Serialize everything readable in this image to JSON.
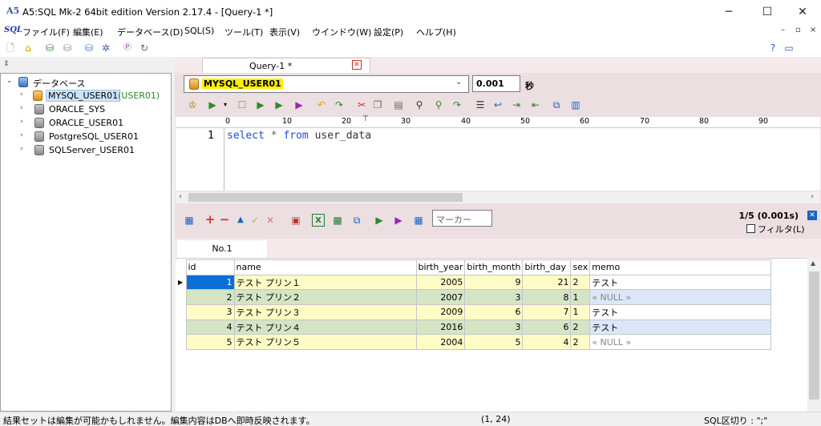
{
  "window": {
    "title": "A5:SQL Mk-2 64bit edition Version 2.17.4 - [Query-1 *]",
    "minimize": "─",
    "maximize": "☐",
    "close": "✕"
  },
  "menu": {
    "logo": "SQL",
    "items": [
      "ファイル(F)",
      "編集(E)",
      "データベース(D)",
      "SQL(S)",
      "ツール(T)",
      "表示(V)",
      "ウインドウ(W)",
      "設定(P)",
      "ヘルプ(H)"
    ],
    "mdi_min": "–",
    "mdi_restore": "▫",
    "mdi_close": "×"
  },
  "tree": {
    "root": "データベース",
    "items": [
      {
        "label": "MYSQL_USER01",
        "suffix": "(USER01)",
        "selected": true
      },
      {
        "label": "ORACLE_SYS"
      },
      {
        "label": "ORACLE_USER01"
      },
      {
        "label": "PostgreSQL_USER01"
      },
      {
        "label": "SQLServer_USER01"
      }
    ]
  },
  "query_tab": {
    "label": "Query-1 *",
    "close": "✕"
  },
  "connection": {
    "value": "MYSQL_USER01",
    "timeout": "0.001",
    "unit": "秒"
  },
  "ruler": [
    "0",
    "10",
    "20",
    "30",
    "40",
    "50",
    "60",
    "70",
    "80",
    "90"
  ],
  "editor": {
    "line_number": "1",
    "kw1": "select",
    "star": "*",
    "kw2": "from",
    "table": "user_data"
  },
  "result": {
    "marker_placeholder": "マーカー",
    "count": "1/5 (0.001s)",
    "filter_label": "フィルタ(L)",
    "tab": "No.1"
  },
  "grid": {
    "columns": [
      "id",
      "name",
      "birth_year",
      "birth_month",
      "birth_day",
      "sex",
      "memo"
    ],
    "rows": [
      [
        "1",
        "テスト プリン１",
        "2005",
        "9",
        "21",
        "2",
        "テスト"
      ],
      [
        "2",
        "テスト プリン２",
        "2007",
        "3",
        "8",
        "1",
        "« NULL »"
      ],
      [
        "3",
        "テスト プリン３",
        "2009",
        "6",
        "7",
        "1",
        "テスト"
      ],
      [
        "4",
        "テスト プリン４",
        "2016",
        "3",
        "6",
        "2",
        "テスト"
      ],
      [
        "5",
        "テスト プリン５",
        "2004",
        "5",
        "4",
        "2",
        "« NULL »"
      ]
    ]
  },
  "status": {
    "message": "結果セットは編集が可能かもしれません。編集内容はDBへ即時反映されます。",
    "position": "(1, 24)",
    "delimiter": "SQL区切り : \";\""
  },
  "colors": {
    "panel_pink": "#ecdfe1",
    "row_yellow": "#fffbc6",
    "row_green": "#d6e4c6",
    "row_blue": "#dbe7f9",
    "selected_cell": "#0a6fd6",
    "keyword_blue": "#1a4fd6"
  },
  "icons": [
    "new-icon",
    "open-icon",
    "db-connect-icon",
    "db-disconnect-icon",
    "db-list-icon",
    "gear-icon",
    "plugin-icon",
    "refresh-icon",
    "help-icon"
  ]
}
